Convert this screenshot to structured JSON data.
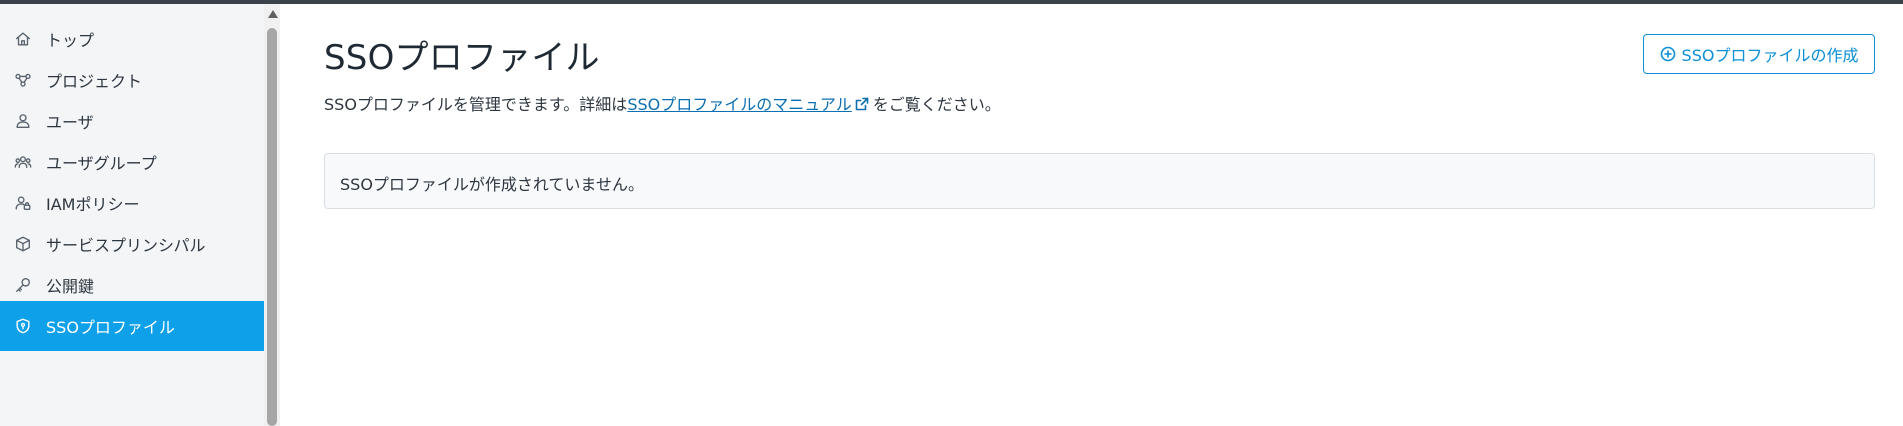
{
  "sidebar": {
    "items": [
      {
        "label": "トップ",
        "icon": "home-icon",
        "active": false
      },
      {
        "label": "プロジェクト",
        "icon": "project-nodes-icon",
        "active": false
      },
      {
        "label": "ユーザ",
        "icon": "user-icon",
        "active": false
      },
      {
        "label": "ユーザグループ",
        "icon": "user-group-icon",
        "active": false
      },
      {
        "label": "IAMポリシー",
        "icon": "user-policy-icon",
        "active": false
      },
      {
        "label": "サービスプリンシパル",
        "icon": "cube-icon",
        "active": false
      },
      {
        "label": "公開鍵",
        "icon": "key-icon",
        "active": false
      },
      {
        "label": "SSOプロファイル",
        "icon": "shield-icon",
        "active": true
      }
    ],
    "active_color": "#0ea0e9"
  },
  "main": {
    "title": "SSOプロファイル",
    "description_prefix": "SSOプロファイルを管理できます。詳細は",
    "manual_link": "SSOプロファイルのマニュアル",
    "description_suffix": "をご覧ください。",
    "create_button": "SSOプロファイルの作成",
    "empty_message": "SSOプロファイルが作成されていません。"
  },
  "colors": {
    "topbar": "#3b424a",
    "accent": "#0b8fd6",
    "link": "#0b6fb1"
  }
}
